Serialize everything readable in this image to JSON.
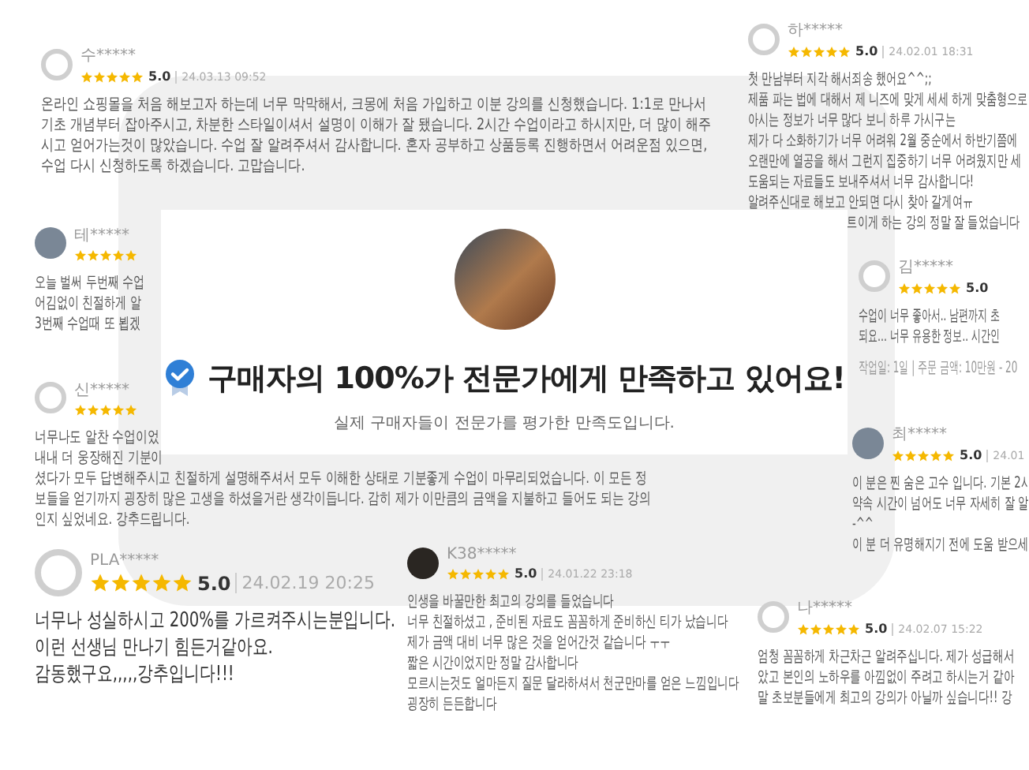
{
  "reviews": [
    {
      "kind": "default",
      "name": "수*****",
      "stars": 5,
      "score": "5.0",
      "date": "24.03.13 09:52",
      "lines": [
        "온라인 쇼핑몰을 처음 해보고자 하는데 너무 막막해서, 크몽에 처음 가입하고 이분 강의를 신청했습니다. 1:1로 만나서",
        "기초 개념부터 잡아주시고, 차분한 스타일이셔서 설명이 이해가 잘 됐습니다. 2시간 수업이라고 하시지만, 더 많이 해주",
        "시고 얻어가는것이 많았습니다. 수업 잘 알려주셔서 감사합니다. 혼자 공부하고 상품등록 진행하면서 어려운점 있으면,",
        "수업 다시 신청하도록 하겠습니다. 고맙습니다."
      ]
    },
    {
      "kind": "default",
      "name": "하*****",
      "stars": 5,
      "score": "5.0",
      "date": "24.02.01 18:31",
      "lines": [
        "첫 만남부터 지각 해서죄송 했어요^^;;",
        "제품 파는 법에 대해서 제 니즈에 맞게 세세 하게 맞춤형으로",
        "아시는 정보가 너무 많다 보니 하루 가시구는",
        "제가 다 소화하기가 너무 어려워 2월 중순에서 하반기쯤에",
        "오랜만에 열공을 해서 그런지 집중하기 너무 어려웠지만 세",
        "도움되는 자료들도 보내주셔서 너무 감사합니다!",
        "알려주신대로 해보고 안되면 다시 찾아 갈게여ㅠ"
      ],
      "tail": "트이게 하는 강의 정말 잘 들었습니다"
    },
    {
      "kind": "photo",
      "name": "테*****",
      "stars": 5,
      "lines": [
        "오늘 벌써 두번째 수업",
        "어김없이 친절하게 알",
        "3번째 수업때 또 뵙겠"
      ]
    },
    {
      "kind": "default",
      "name": "김*****",
      "stars": 5,
      "score": "5.0",
      "lines": [
        "수업이 너무 좋아서.. 남편까지 초",
        "되요… 너무 유용한 정보.. 시간인"
      ],
      "note": "작업일: 1일 | 주문 금액: 10만원 - 20"
    },
    {
      "kind": "default",
      "name": "신*****",
      "stars": 5,
      "lines": [
        "너무나도 알찬 수업이었",
        "내내 더 웅장해진 기분이",
        "셨다가 모두 답변해주시고 친절하게 설명해주셔서 모두 이해한 상태로 기분좋게 수업이 마무리되었습니다. 이 모든 정",
        "보들을 얻기까지 굉장히 많은 고생을 하셨을거란 생각이듭니다. 감히 제가 이만큼의 금액을 지불하고 들어도 되는 강의",
        "인지 싶었네요. 강추드립니다."
      ]
    },
    {
      "kind": "photo",
      "name": "최*****",
      "stars": 5,
      "score": "5.0",
      "date": "24.01",
      "lines": [
        "이 분은 찐 숨은 고수 입니다. 기본 2시",
        "약속 시간이 넘어도 너무 자세히 잘 알",
        "-^^",
        "이 분 더 유명해지기 전에 도움 받으세"
      ]
    },
    {
      "kind": "default",
      "name": "PLA*****",
      "stars": 5,
      "score": "5.0",
      "date": "24.02.19 20:25",
      "lines": [
        "너무나 성실하시고 200%를 가르켜주시는분입니다.",
        "이런 선생님 만나기 힘든거같아요.",
        "감동했구요,,,,,강추입니다!!!"
      ]
    },
    {
      "kind": "dark",
      "name": "K38*****",
      "stars": 5,
      "score": "5.0",
      "date": "24.01.22 23:18",
      "lines": [
        "인생을 바꿀만한 최고의 강의를 들었습니다",
        "너무 친절하셨고 , 준비된 자료도 꼼꼼하게 준비하신 티가 났습니다",
        "제가 금액 대비 너무 많은 것을 얻어간것 같습니다 ㅜㅜ",
        "짧은 시간이었지만 정말 감사합니다",
        "모르시는것도 얼마든지 질문 달라하셔서 천군만마를 얻은 느낌입니다",
        "굉장히 든든합니다"
      ]
    },
    {
      "kind": "default",
      "name": "나*****",
      "stars": 5,
      "score": "5.0",
      "date": "24.02.07 15:22",
      "lines": [
        "엄청 꼼꼼하게 차근차근 알려주십니다. 제가 성급해서",
        "았고 본인의 노하우를 아낌없이 주려고 하시는거 같아",
        "말 초보분들에게 최고의 강의가 아닐까 싶습니다!! 강"
      ]
    }
  ],
  "banner": {
    "title": "구매자의 **100%**가 전문가에게 만족하고 있어요!",
    "subtitle": "실제 구매자들이 전문가를 평가한 만족도입니다."
  }
}
